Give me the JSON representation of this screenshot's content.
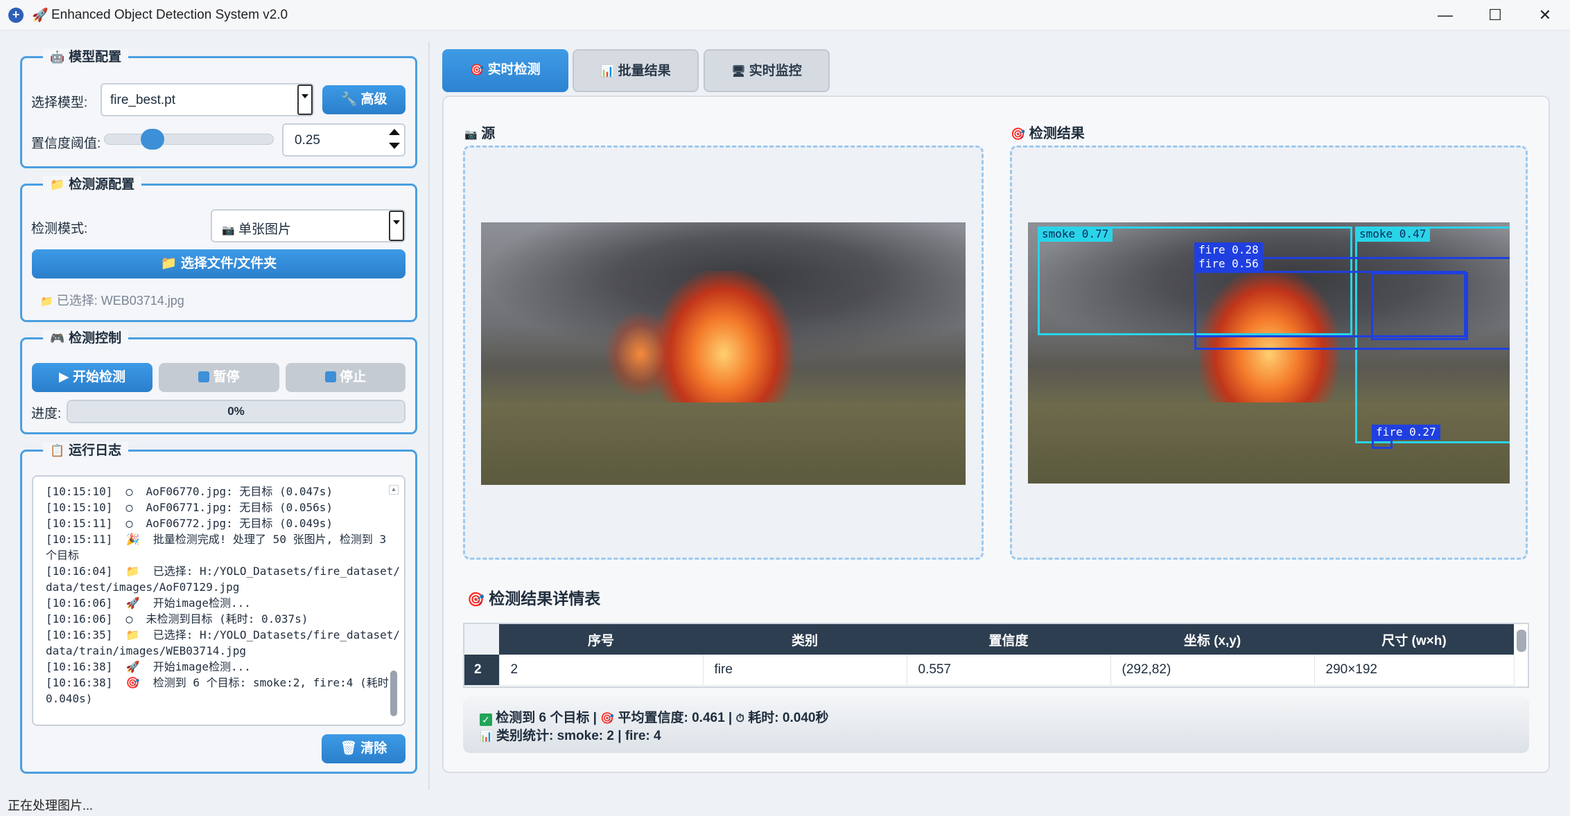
{
  "window": {
    "title": "Enhanced Object Detection System v2.0",
    "app_icon": "+",
    "rocket_icon": "🚀",
    "min": "—",
    "max": "☐",
    "close": "✕"
  },
  "model_config": {
    "title": "模型配置",
    "icon": "🤖",
    "select_label": "选择模型:",
    "model_value": "fire_best.pt",
    "advanced_btn": "高级",
    "advanced_icon": "🔧",
    "confidence_label": "置信度阈值:",
    "confidence_value": "0.25",
    "slider_level": 0.25
  },
  "source_config": {
    "title": "检测源配置",
    "icon": "📁",
    "mode_label": "检测模式:",
    "mode_value": "单张图片",
    "mode_icon": "📷",
    "select_btn": "选择文件/文件夹",
    "select_icon": "📁",
    "selected_text": "已选择: WEB03714.jpg"
  },
  "control": {
    "title": "检测控制",
    "icon": "🎮",
    "start_btn": "开始检测",
    "pause_btn": "暂停",
    "stop_btn": "停止",
    "progress_label": "进度:",
    "progress_text": "0%",
    "progress_value": 0
  },
  "log": {
    "title": "运行日志",
    "icon": "📋",
    "clear_btn": "清除",
    "clear_icon": "🗑",
    "lines": [
      "[10:15:10]  ◯  AoF06770.jpg: 无目标 (0.047s)",
      "[10:15:10]  ◯  AoF06771.jpg: 无目标 (0.056s)",
      "[10:15:11]  ◯  AoF06772.jpg: 无目标 (0.049s)",
      "[10:15:11]  🎉  批量检测完成! 处理了 50 张图片, 检测到 3",
      "个目标",
      "[10:16:04]  📁  已选择: H:/YOLO_Datasets/fire_dataset/",
      "data/test/images/AoF07129.jpg",
      "[10:16:06]  🚀  开始image检测...",
      "[10:16:06]  ◯  未检测到目标 (耗时: 0.037s)",
      "[10:16:35]  📁  已选择: H:/YOLO_Datasets/fire_dataset/",
      "data/train/images/WEB03714.jpg",
      "[10:16:38]  🚀  开始image检测...",
      "[10:16:38]  🎯  检测到 6 个目标: smoke:2, fire:4 (耗时:",
      "0.040s)"
    ]
  },
  "tabs": [
    {
      "label": "实时检测",
      "icon": "🎯"
    },
    {
      "label": "批量结果",
      "icon": "📊"
    },
    {
      "label": "实时监控",
      "icon": "🖥"
    }
  ],
  "source_panel": {
    "title": "源",
    "icon": "📷"
  },
  "result_panel": {
    "title": "检测结果",
    "icon": "🎯"
  },
  "detections": [
    {
      "label": "smoke 0.77",
      "color": "#2ad4e8"
    },
    {
      "label": "smoke 0.47",
      "color": "#2ad4e8"
    },
    {
      "label": "fire 0.28",
      "color": "#1f3fe0"
    },
    {
      "label": "fire 0.56",
      "color": "#1f3fe0"
    },
    {
      "label": "fire 0.27",
      "color": "#1f3fe0"
    }
  ],
  "table": {
    "title": "检测结果详情表",
    "icon": "🎯",
    "headers": [
      "序号",
      "类别",
      "置信度",
      "坐标 (x,y)",
      "尺寸 (w×h)"
    ],
    "rows": [
      {
        "index": "2",
        "cells": [
          "2",
          "fire",
          "0.557",
          "(292,82)",
          "290×192"
        ]
      }
    ]
  },
  "summary": {
    "line1_a": "检测到 6 个目标 |",
    "line1_b": "平均置信度: 0.461 |",
    "line1_c": "耗时: 0.040秒",
    "line2": "类别统计: smoke: 2 | fire: 4",
    "check_icon": "✓",
    "target_icon": "🎯",
    "timer_icon": "⏱",
    "chart_icon": "📊"
  },
  "status_bar": "正在处理图片...",
  "colors": {
    "accent": "#3d9ae6",
    "header": "#2d3e50"
  }
}
